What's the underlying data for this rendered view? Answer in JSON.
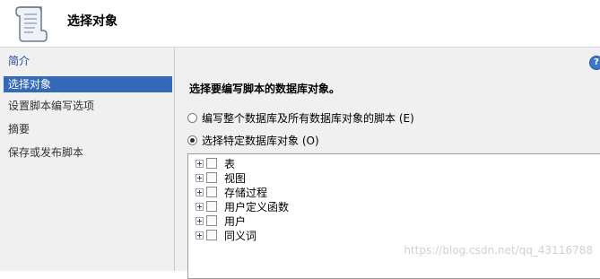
{
  "header": {
    "title": "选择对象",
    "icon": "script-scroll-icon"
  },
  "nav": {
    "items": [
      {
        "label": "简介"
      },
      {
        "label": "选择对象"
      },
      {
        "label": "设置脚本编写选项"
      },
      {
        "label": "摘要"
      },
      {
        "label": "保存或发布脚本"
      }
    ],
    "selected": "选择对象"
  },
  "main": {
    "help_icon": "help-icon",
    "section_title": "选择要编写脚本的数据库对象。",
    "radio_all": {
      "label": "编写整个数据库及所有数据库对象的脚本 (E)",
      "checked": false
    },
    "radio_specific": {
      "label": "选择特定数据库对象 (O)",
      "checked": true
    },
    "tree_items": [
      {
        "label": "表"
      },
      {
        "label": "视图"
      },
      {
        "label": "存储过程"
      },
      {
        "label": "用户定义函数"
      },
      {
        "label": "用户"
      },
      {
        "label": "同义词"
      }
    ]
  },
  "watermark": "https://blog.csdn.net/qq_43116788"
}
